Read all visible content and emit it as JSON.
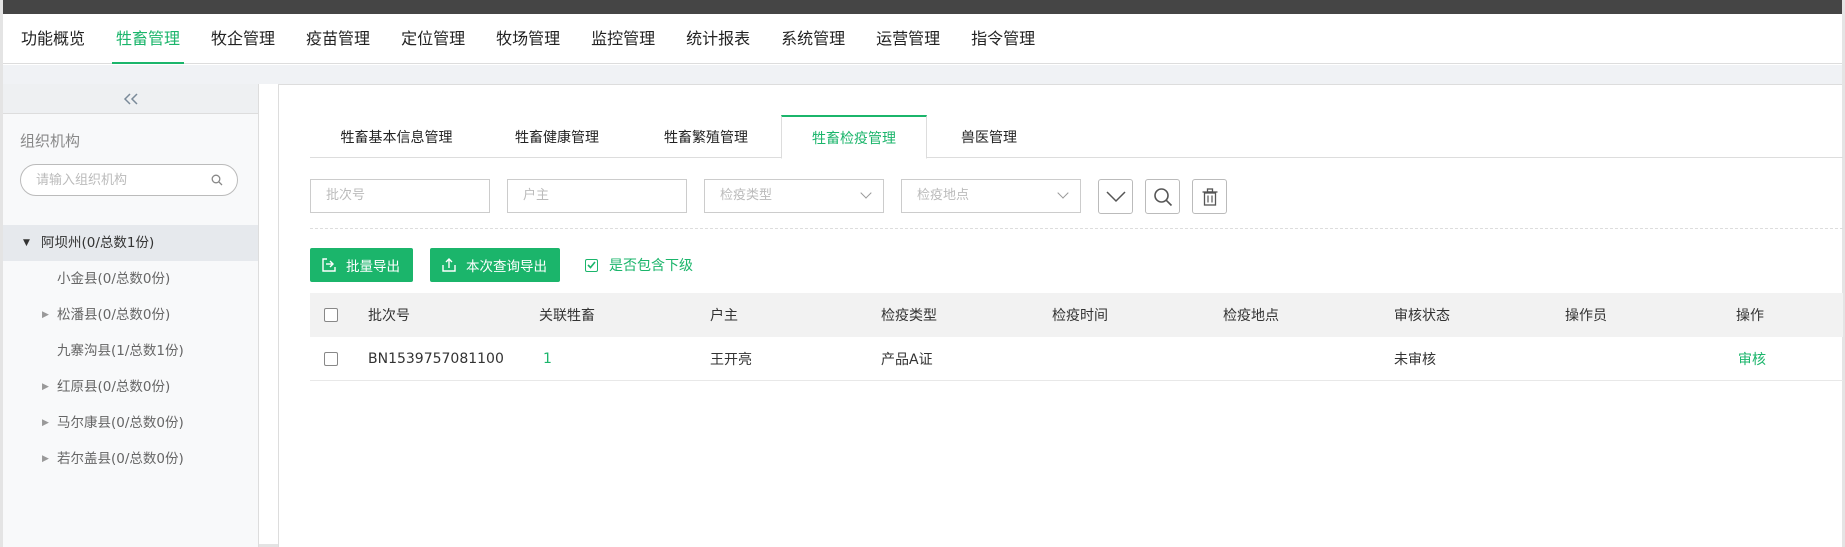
{
  "nav": {
    "items": [
      "功能概览",
      "牲畜管理",
      "牧企管理",
      "疫苗管理",
      "定位管理",
      "牧场管理",
      "监控管理",
      "统计报表",
      "系统管理",
      "运营管理",
      "指令管理"
    ],
    "active_index": 1
  },
  "sidebar": {
    "collapse_icon": "double-chevron-left-icon",
    "title": "组织机构",
    "search_placeholder": "请输入组织机构",
    "root": "阿坝州(0/总数1份)",
    "children": [
      {
        "label": "小金县(0/总数0份)",
        "expandable": false
      },
      {
        "label": "松潘县(0/总数0份)",
        "expandable": true
      },
      {
        "label": "九寨沟县(1/总数1份)",
        "expandable": false
      },
      {
        "label": "红原县(0/总数0份)",
        "expandable": true
      },
      {
        "label": "马尔康县(0/总数0份)",
        "expandable": true
      },
      {
        "label": "若尔盖县(0/总数0份)",
        "expandable": true
      }
    ]
  },
  "tabs": {
    "items": [
      "牲畜基本信息管理",
      "牲畜健康管理",
      "牲畜繁殖管理",
      "牲畜检疫管理",
      "兽医管理"
    ],
    "active_index": 3
  },
  "filters": {
    "batch_placeholder": "批次号",
    "owner_placeholder": "户主",
    "type_placeholder": "检疫类型",
    "place_placeholder": "检疫地点"
  },
  "actions": {
    "batch_export": "批量导出",
    "query_export": "本次查询导出",
    "include_sub": "是否包含下级",
    "include_sub_checked": true
  },
  "table": {
    "columns": [
      "批次号",
      "关联牲畜",
      "户主",
      "检疫类型",
      "检疫时间",
      "检疫地点",
      "审核状态",
      "操作员",
      "操作"
    ],
    "rows": [
      {
        "batch": "BN1539757081100",
        "livestock": "1",
        "owner": "王开亮",
        "type": "产品A证",
        "time": "",
        "place": "",
        "status": "未审核",
        "operator": "",
        "action": "审核"
      }
    ]
  },
  "colors": {
    "accent": "#1bb56b",
    "topbar": "#454545"
  }
}
